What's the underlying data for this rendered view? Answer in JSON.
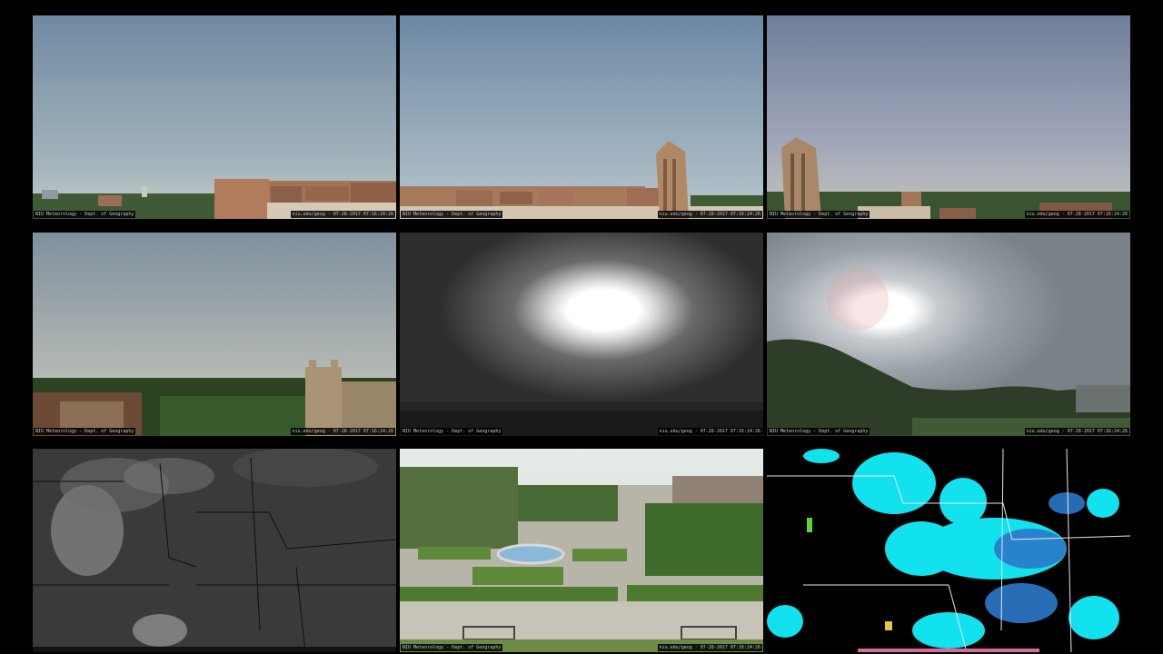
{
  "captions": {
    "t1_left": "NIU Meteorology - Dept. of Geography",
    "t1_right": "niu.edu/geog · 07-28-2017 07:16:24:26",
    "t2_left": "NIU Meteorology - Dept. of Geography",
    "t2_right": "niu.edu/geog · 07-28-2017 07:16:24:26",
    "t3_left": "NIU Meteorology - Dept. of Geography",
    "t3_right": "niu.edu/geog · 07-28-2017 07:16:24:26",
    "t4_left": "NIU Meteorology - Dept. of Geography",
    "t4_right": "niu.edu/geog · 07-28-2017 07:16:24:26",
    "t5_left": "NIU Meteorology - Dept. of Geography",
    "t5_right": "niu.edu/geog · 07-28-2017 07:16:24:26",
    "t6_left": "NIU Meteorology - Dept. of Geography",
    "t6_right": "niu.edu/geog · 07-28-2017 07:16:24:26",
    "t8_left": "NIU Meteorology - Dept. of Geography",
    "t8_right": "niu.edu/geog · 07-28-2017 07:16:24:26"
  },
  "colors": {
    "background": "#000000",
    "sky_top": "#7a93aa",
    "sky_bottom": "#b6c0c2",
    "brick": "#a8775a",
    "tree": "#2d4a1e",
    "radar_cyan": "#12e1ee",
    "radar_blue": "#2b78c8"
  }
}
